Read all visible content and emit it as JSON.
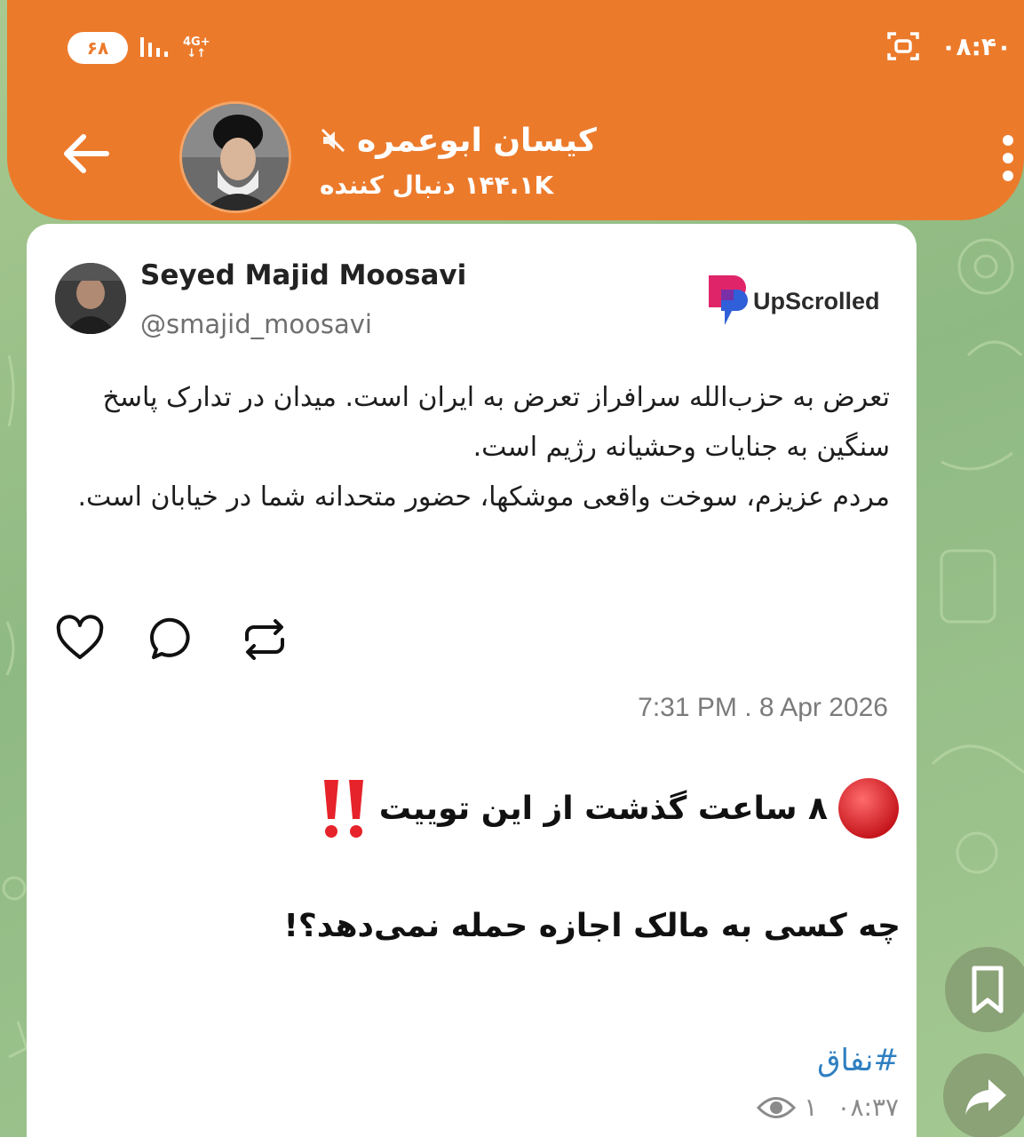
{
  "status_bar": {
    "battery": "۶۸",
    "network": "4G+",
    "time": "۰۸:۴۰"
  },
  "header": {
    "channel_name": "کیسان ابوعمره",
    "followers": "۱۴۴.۱K دنبال کننده"
  },
  "post": {
    "author_name": "Seyed Majid Moosavi",
    "author_handle": "@smajid_moosavi",
    "brand_name": "UpScrolled",
    "paragraph_1": "تعرض به حزب‌الله سرافراز تعرض به ایران است. میدان در تدارک پاسخ سنگین به جنایات وحشیانه رژیم است.",
    "paragraph_2": "مردم عزیزم، سوخت واقعی موشکها، حضور متحدانه شما در خیابان است.",
    "timestamp": "7:31 PM . 8 Apr 2026",
    "alert_text": "۸ ساعت گذشت از این توییت",
    "question": "چه کسی به مالک اجازه حمله نمی‌دهد؟!",
    "hashtag": "#نفاق",
    "views": "۱",
    "time": "۰۸:۳۷"
  },
  "icons": {
    "back": "arrow-left-icon",
    "mute": "mute-icon",
    "more": "more-vertical-icon",
    "like": "heart-icon",
    "comment": "comment-icon",
    "repost": "repost-icon",
    "bookmark": "bookmark-icon",
    "share": "share-icon",
    "views": "eye-icon"
  },
  "colors": {
    "header": "#ec7a2b",
    "wallpaper": "#9cbf8a",
    "link": "#2f7fc1",
    "brand_pink": "#e0246a",
    "brand_blue": "#2f5fd9"
  }
}
